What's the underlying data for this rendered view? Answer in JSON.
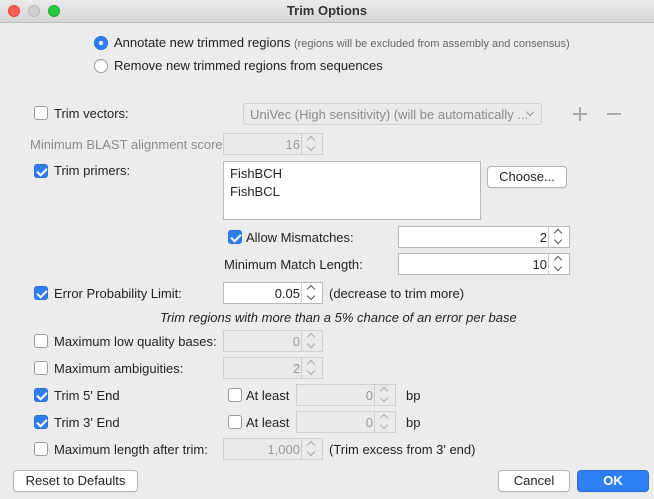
{
  "window": {
    "title": "Trim Options"
  },
  "annotate": {
    "label": "Annotate new trimmed regions",
    "hint": "(regions will be excluded from assembly and consensus)",
    "selected": true
  },
  "remove": {
    "label": "Remove new trimmed regions from sequences",
    "selected": false
  },
  "trim_vectors": {
    "label": "Trim vectors:",
    "checked": false,
    "dropdown": "UniVec (High sensitivity) (will be automatically ..."
  },
  "min_blast": {
    "label": "Minimum BLAST alignment score:",
    "value": "16"
  },
  "trim_primers": {
    "label": "Trim primers:",
    "checked": true,
    "items": [
      "FishBCH",
      "FishBCL"
    ],
    "choose_label": "Choose..."
  },
  "allow_mismatches": {
    "label": "Allow Mismatches:",
    "checked": true,
    "value": "2"
  },
  "min_match_length": {
    "label": "Minimum Match Length:",
    "value": "10"
  },
  "error_prob": {
    "label": "Error Probability Limit:",
    "checked": true,
    "value": "0.05",
    "hint": "(decrease to trim more)"
  },
  "trim_note": "Trim regions with more than a 5% chance of an error per base",
  "max_low_quality": {
    "label": "Maximum low quality bases:",
    "checked": false,
    "value": "0"
  },
  "max_ambiguities": {
    "label": "Maximum ambiguities:",
    "checked": false,
    "value": "2"
  },
  "trim5": {
    "label": "Trim 5' End",
    "checked": true,
    "atleast_label": "At least",
    "atleast_checked": false,
    "value": "0",
    "unit": "bp"
  },
  "trim3": {
    "label": "Trim 3' End",
    "checked": true,
    "atleast_label": "At least",
    "atleast_checked": false,
    "value": "0",
    "unit": "bp"
  },
  "max_length": {
    "label": "Maximum length after trim:",
    "checked": false,
    "value": "1,000",
    "hint": "(Trim excess from 3' end)"
  },
  "buttons": {
    "reset": "Reset to Defaults",
    "cancel": "Cancel",
    "ok": "OK"
  },
  "colors": {
    "accent": "#2f7ff3",
    "window_bg": "#ececec"
  }
}
